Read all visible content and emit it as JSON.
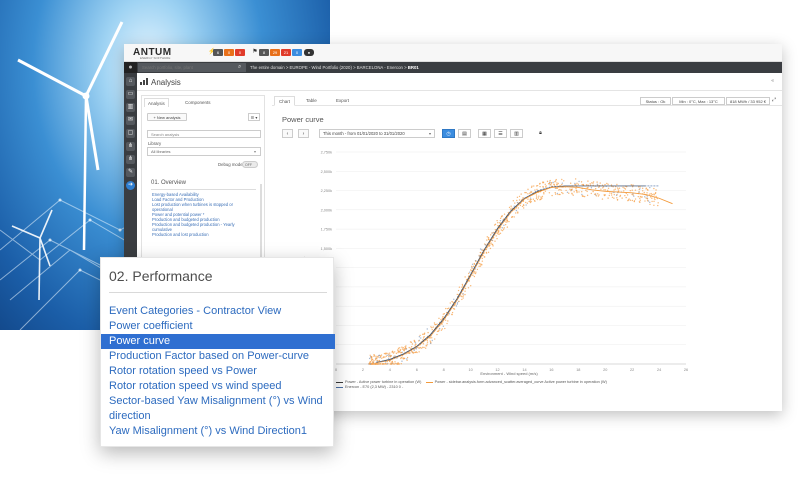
{
  "brand": {
    "logo": "ANTUM",
    "logo_sub": "ENERGY SOFTWARE"
  },
  "topbar": {
    "badges": [
      {
        "text": "6",
        "color": "#555555"
      },
      {
        "text": "0",
        "color": "#e8701a"
      },
      {
        "text": "0",
        "color": "#e03b2a"
      }
    ],
    "badges_right": [
      {
        "text": "8",
        "color": "#555555"
      },
      {
        "text": "29",
        "color": "#e8701a"
      },
      {
        "text": "21",
        "color": "#e03b2a"
      },
      {
        "text": "0",
        "color": "#3b8de0"
      }
    ]
  },
  "navbar": {
    "search_placeholder": "Search portfolio, site, plant",
    "breadcrumb": [
      "The entire domain",
      "EUROPE - Wind Portfolio (2020)",
      "BARCELONA - Enercon",
      "BR01"
    ]
  },
  "page": {
    "title": "Analysis"
  },
  "left_panel": {
    "tabs": [
      "Analysis",
      "Components"
    ],
    "new_analysis": "+ New analysis",
    "menu_button": "☰ ▾",
    "search_placeholder": "Search analysis",
    "library_label": "Library",
    "library_value": "All libraries",
    "debug_label": "Debug mode",
    "debug_value": "OFF",
    "section_title": "01. Overview",
    "items": [
      "Energy-based Availability",
      "Load Factor and Production",
      "Lost production when turbines is stopped or",
      "operational",
      "Power and potential power *",
      "Production and budgeted production",
      "Production and budgeted production - Yearly",
      "cumulative",
      "Production and lost production"
    ]
  },
  "right_panel": {
    "tabs": [
      "Chart",
      "Table",
      "Export"
    ],
    "status": "Status : Ok",
    "temperature": "Min : 0°C, Max : 13°C",
    "energy": "818 MWh / 33 952 €",
    "chart_title": "Power curve",
    "period": "This month - from 01/01/2020 to 31/01/2020"
  },
  "chart_data": {
    "type": "scatter",
    "title": "Power curve",
    "xlabel": "Environment - Wind speed (m/s)",
    "ylabel": "Power",
    "xlim": [
      0,
      26
    ],
    "ylim": [
      0,
      2750
    ],
    "x_ticks": [
      "0",
      "2",
      "4",
      "6",
      "8",
      "10",
      "12",
      "14",
      "16",
      "18",
      "20",
      "22",
      "24",
      "26"
    ],
    "y_ticks": [
      "0",
      "250",
      "500",
      "750",
      "1,000",
      "1,250",
      "1,500",
      "1,750",
      "2,000",
      "2,250",
      "2,500",
      "2,750"
    ],
    "y_tick_labels": [
      "",
      "",
      "",
      "",
      "",
      "",
      "1,500k",
      "1,750k",
      "2,000k",
      "2,250k",
      "2,500k",
      "2,750k"
    ],
    "series": [
      {
        "name": "Power - Active power turbine in operation (W)",
        "color": "#3a3a3a",
        "x": [
          3,
          4,
          5,
          6,
          7,
          8,
          9,
          10,
          11,
          12,
          13,
          14,
          15,
          16,
          17,
          18,
          19,
          20,
          21,
          22,
          23
        ],
        "y": [
          20,
          60,
          130,
          230,
          380,
          590,
          850,
          1160,
          1480,
          1760,
          1990,
          2150,
          2240,
          2290,
          2310,
          2310,
          2310,
          2310,
          2310,
          2310,
          2310
        ]
      },
      {
        "name": "Power - sidebar.analysis.form.advanced_scatter.averaged_curve Active power turbine in operation (W)",
        "color": "#f39a3b",
        "x": [
          3,
          4,
          5,
          6,
          7,
          8,
          9,
          10,
          11,
          12,
          13,
          14,
          15,
          16,
          17,
          18,
          19,
          20,
          21,
          22,
          23,
          24,
          25
        ],
        "y": [
          15,
          50,
          120,
          220,
          360,
          570,
          830,
          1140,
          1460,
          1740,
          1970,
          2140,
          2230,
          2290,
          2300,
          2290,
          2260,
          2240,
          2230,
          2220,
          2200,
          2150,
          2080
        ]
      },
      {
        "name": "Enercon - E70 (2,3 MW) - 2310 0 -",
        "color": "#4a6fa5",
        "x": [
          3,
          4,
          5,
          6,
          7,
          8,
          9,
          10,
          11,
          12,
          13,
          14,
          15,
          16,
          17,
          18,
          19,
          20,
          21,
          22,
          23,
          24
        ],
        "y": [
          20,
          55,
          125,
          225,
          370,
          580,
          840,
          1150,
          1470,
          1750,
          1980,
          2150,
          2250,
          2300,
          2310,
          2310,
          2310,
          2310,
          2310,
          2310,
          2310,
          2310
        ]
      }
    ]
  },
  "zoom": {
    "title": "02. Performance",
    "items": [
      "Event Categories - Contractor View",
      "Power coefficient",
      "Power curve",
      "Production Factor based on Power-curve",
      "Rotor rotation speed vs Power",
      "Rotor rotation speed vs wind speed",
      "Sector-based Yaw Misalignment (°) vs Wind direction",
      "Yaw Misalignment (°) vs Wind Direction1"
    ],
    "selected_index": 2
  }
}
